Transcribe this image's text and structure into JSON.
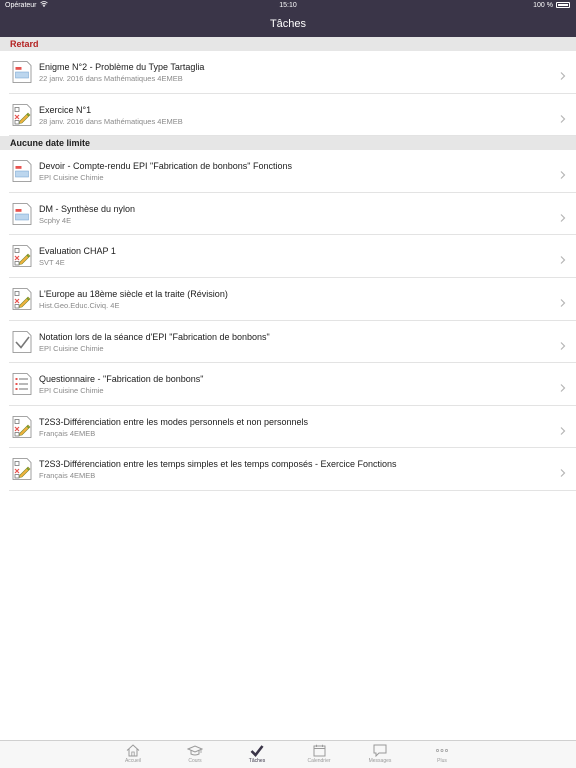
{
  "status_bar": {
    "carrier": "Opérateur",
    "time": "15:10",
    "battery": "100 %"
  },
  "nav": {
    "title": "Tâches"
  },
  "sections": [
    {
      "header": "Retard",
      "items": [
        {
          "title": "Enigme N°2 - Problème du Type Tartaglia",
          "subtitle": "22 janv. 2016 dans Mathématiques 4EMEB",
          "icon": "document-form-icon"
        },
        {
          "title": "Exercice N°1",
          "subtitle": "28 janv. 2016 dans Mathématiques 4EMEB",
          "icon": "quiz-pencil-icon"
        }
      ]
    },
    {
      "header": "Aucune date limite",
      "items": [
        {
          "title": "Devoir - Compte-rendu EPI \"Fabrication de bonbons\" Fonctions",
          "subtitle": "EPI Cuisine Chimie",
          "icon": "document-form-icon"
        },
        {
          "title": "DM - Synthèse du nylon",
          "subtitle": "Scphy 4E",
          "icon": "document-form-icon"
        },
        {
          "title": "Evaluation CHAP 1",
          "subtitle": "SVT 4E",
          "icon": "quiz-pencil-icon"
        },
        {
          "title": "L'Europe au 18ème siècle et la traite (Révision)",
          "subtitle": "Hist.Geo.Educ.Civiq. 4E",
          "icon": "quiz-pencil-icon"
        },
        {
          "title": "Notation lors de la séance d'EPI \"Fabrication de bonbons\"",
          "subtitle": "EPI Cuisine Chimie",
          "icon": "checkmark-document-icon"
        },
        {
          "title": "Questionnaire - \"Fabrication de bonbons\"",
          "subtitle": "EPI Cuisine Chimie",
          "icon": "questionnaire-icon"
        },
        {
          "title": "T2S3-Différenciation entre les modes personnels et non personnels",
          "subtitle": "Français 4EMEB",
          "icon": "quiz-pencil-icon"
        },
        {
          "title": "T2S3-Différenciation entre les temps simples et les temps composés - Exercice Fonctions",
          "subtitle": "Français 4EMEB",
          "icon": "quiz-pencil-icon"
        }
      ]
    }
  ],
  "tabbar": {
    "tabs": [
      {
        "label": "Accueil",
        "icon": "home-icon"
      },
      {
        "label": "Cours",
        "icon": "graduation-cap-icon"
      },
      {
        "label": "Tâches",
        "icon": "checkmark-icon",
        "active": true
      },
      {
        "label": "Calendrier",
        "icon": "calendar-icon"
      },
      {
        "label": "Messages",
        "icon": "chat-bubble-icon"
      },
      {
        "label": "Plus",
        "icon": "more-dots-icon"
      }
    ]
  },
  "colors": {
    "nav_background": "#3a3548",
    "late_header_text": "#b42323",
    "section_background": "#e6e6e6",
    "active_tab": "#3a3548"
  }
}
